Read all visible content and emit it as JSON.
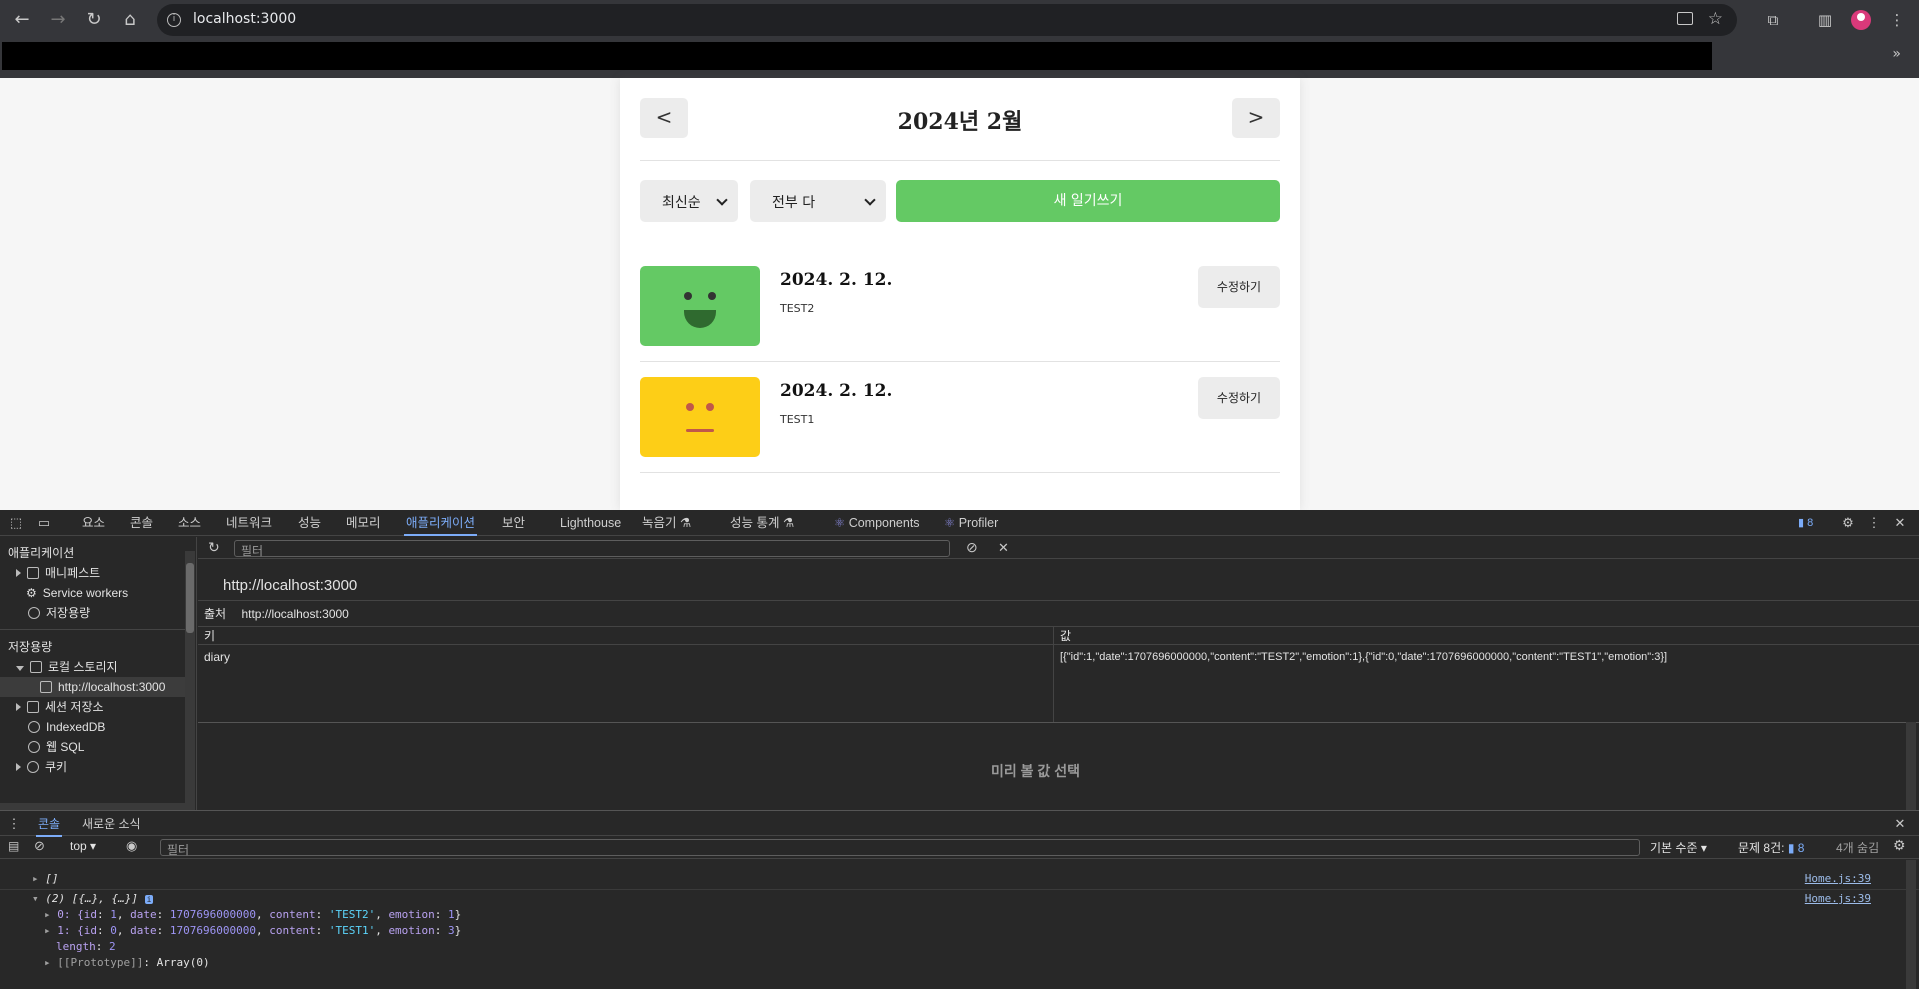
{
  "browser": {
    "url": "localhost:3000"
  },
  "diary_app": {
    "header_title": "2024년 2월",
    "prev_label": "<",
    "next_label": ">",
    "sort_select": "최신순",
    "filter_select": "전부 다",
    "new_button": "새 일기쓰기",
    "entries": [
      {
        "date": "2024. 2. 12.",
        "content": "TEST2",
        "edit": "수정하기",
        "emotion_color": "#64c964"
      },
      {
        "date": "2024. 2. 12.",
        "content": "TEST1",
        "edit": "수정하기",
        "emotion_color": "#fdce17"
      }
    ]
  },
  "devtools": {
    "tabs": [
      "요소",
      "콘솔",
      "소스",
      "네트워크",
      "성능",
      "메모리",
      "애플리케이션",
      "보안",
      "Lighthouse",
      "녹음기 ⚗",
      "성능 통계 ⚗",
      "Components",
      "Profiler"
    ],
    "active_tab": "애플리케이션",
    "issues_count": "8",
    "sidebar": {
      "section_app": "애플리케이션",
      "manifest": "매니페스트",
      "service_workers": "Service workers",
      "storage_overview": "저장용량",
      "section_storage": "저장용량",
      "local_storage": "로컬 스토리지",
      "local_origin": "http://localhost:3000",
      "session_storage": "세션 저장소",
      "indexeddb": "IndexedDB",
      "websql": "웹 SQL",
      "cookies": "쿠키"
    },
    "filter_placeholder": "필터",
    "origin_title": "http://localhost:3000",
    "origin_label": "출처",
    "origin_value": "http://localhost:3000",
    "table_headers": {
      "key": "키",
      "value": "값"
    },
    "rows": [
      {
        "key": "diary",
        "value": "[{\"id\":1,\"date\":1707696000000,\"content\":\"TEST2\",\"emotion\":1},{\"id\":0,\"date\":1707696000000,\"content\":\"TEST1\",\"emotion\":3}]"
      }
    ],
    "empty_hint": "미리 볼 값 선택",
    "drawer_tabs": {
      "console": "콘솔",
      "news": "새로운 소식"
    },
    "console_bar": {
      "context": "top",
      "filter_placeholder": "필터",
      "level": "기본 수준",
      "issues_label": "문제 8건:",
      "issues_count": "8",
      "hidden": "4개 숨김"
    },
    "console_lines": {
      "line1": "[]",
      "line2_head": "(2) [{…}, {…}]",
      "line2_item0_prefix": "0: {",
      "line2_item0_id": "1",
      "line2_item0_date": "1707696000000",
      "line2_item0_content": "'TEST2'",
      "line2_item0_emotion": "1",
      "line2_item1_prefix": "1: {",
      "line2_item1_id": "0",
      "line2_item1_date": "1707696000000",
      "line2_item1_content": "'TEST1'",
      "line2_item1_emotion": "3",
      "length_label": "length",
      "length_value": "2",
      "proto_label": "[[Prototype]]",
      "proto_value": "Array(0)",
      "source": "Home.js:39"
    }
  }
}
